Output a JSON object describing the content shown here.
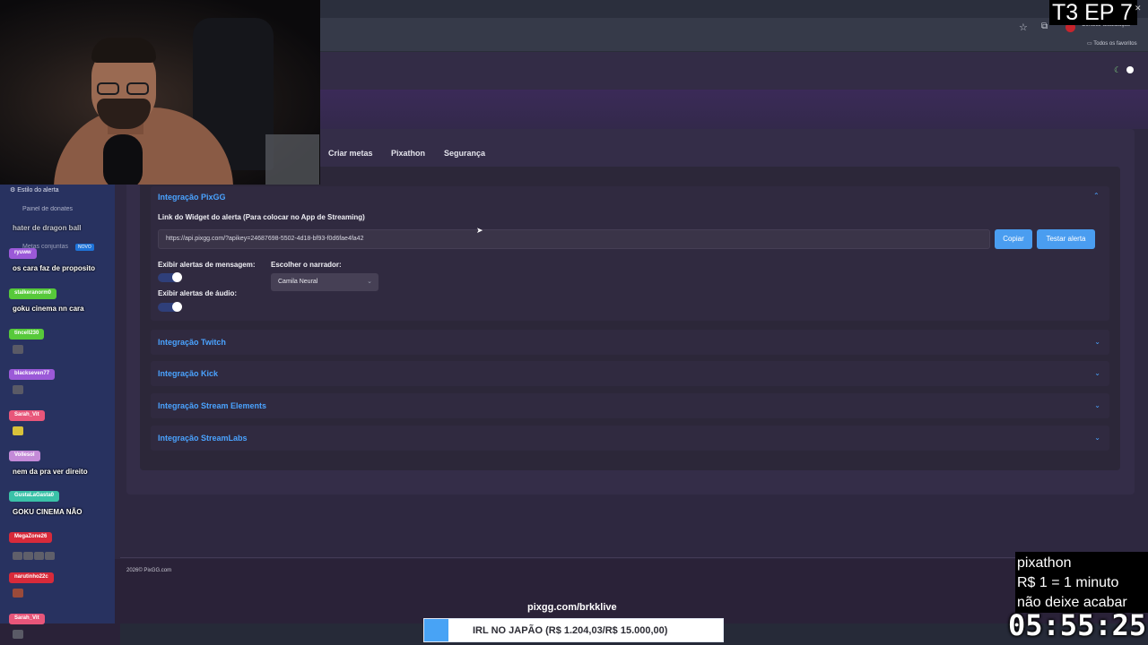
{
  "browser": {
    "update_button": "Concluir atualização",
    "bookmarks_all": "Todos os favoritos"
  },
  "page": {
    "tabs": [
      "Criar metas",
      "Pixathon",
      "Segurança"
    ],
    "pixgg": {
      "title": "Integração PixGG",
      "widget_label": "Link do Widget do alerta (Para colocar no App de Streaming)",
      "widget_url": "https://api.pixgg.com/?apikey=24687698-5502-4d18-bf93-f0d6fae4fa42",
      "copy_button": "Copiar",
      "test_button": "Testar alerta",
      "message_alerts_label": "Exibir alertas de mensagem:",
      "audio_alerts_label": "Exibir alertas de áudio:",
      "narrator_label": "Escolher o narrador:",
      "narrator_value": "Camila Neural"
    },
    "integrations": [
      "Integração Twitch",
      "Integração Kick",
      "Integração Stream Elements",
      "Integração StreamLabs"
    ],
    "footer": "2026© PixGG.com"
  },
  "sidebar": {
    "items": [
      "Estilo do alerta",
      "Painel de donates",
      "Metas conjuntas"
    ],
    "new_badge": "NOVO"
  },
  "chat": [
    {
      "user": "ryuww",
      "color": "#9b59d8",
      "message": "os cara faz de proposito"
    },
    {
      "user": "stalkeranorm0",
      "color": "#57c93a",
      "message": "goku cinema nn cara"
    },
    {
      "user": "tincell230",
      "color": "#57c93a",
      "message": ""
    },
    {
      "user": "blackseven77",
      "color": "#9b59d8",
      "message": ""
    },
    {
      "user": "Sarah_Vit",
      "color": "#e8567a",
      "message": ""
    },
    {
      "user": "Vollesol",
      "color": "#c48ad8",
      "message": "nem da pra ver direito"
    },
    {
      "user": "GustaLaGasta0",
      "color": "#3ac2a8",
      "message": "GOKU CINEMA NÃO"
    },
    {
      "user": "MegaZone26",
      "color": "#d82a3a",
      "message": ""
    },
    {
      "user": "narutinho22c",
      "color": "#d82a3a",
      "message": ""
    },
    {
      "user": "Sarah_Vit",
      "color": "#e8567a",
      "message": ""
    }
  ],
  "chat_top_message": "hater de dragon ball",
  "overlay": {
    "episode": "T3 EP 7",
    "promo_lines": [
      "pixathon",
      "R$ 1 = 1 minuto",
      "não deixe acabar"
    ],
    "timer": "05:55:25",
    "stream_url": "pixgg.com/brkklive",
    "goal_text": "IRL NO JAPÃO (R$ 1.204,03/R$ 15.000,00)",
    "goal_progress": 0.08
  }
}
